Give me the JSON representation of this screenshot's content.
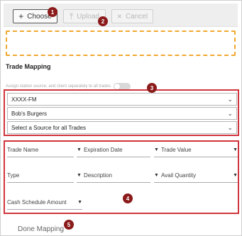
{
  "toolbar": {
    "choose_label": "Choose",
    "upload_label": "Upload",
    "cancel_label": "Cancel"
  },
  "section_title": "Trade Mapping",
  "toggle_label": "Assign station source, and client separately to all trades",
  "selects": {
    "station": "XXXX-FM",
    "client": "Bob's Burgers",
    "source": "Select a Source for all Trades"
  },
  "mapping_fields": {
    "trade_name": "Trade Name",
    "expiration_date": "Expiration Date",
    "trade_value": "Trade Value",
    "type": "Type",
    "description": "Description",
    "avail_quantity": "Avail Quantity",
    "cash_schedule_amount": "Cash Schedule Amount"
  },
  "badges": [
    "1",
    "2",
    "3",
    "4",
    "5"
  ],
  "done_label": "Done Mapping",
  "colors": {
    "highlight": "#d0343c",
    "badge": "#8b1a1a",
    "dropzone": "#f0a830"
  }
}
